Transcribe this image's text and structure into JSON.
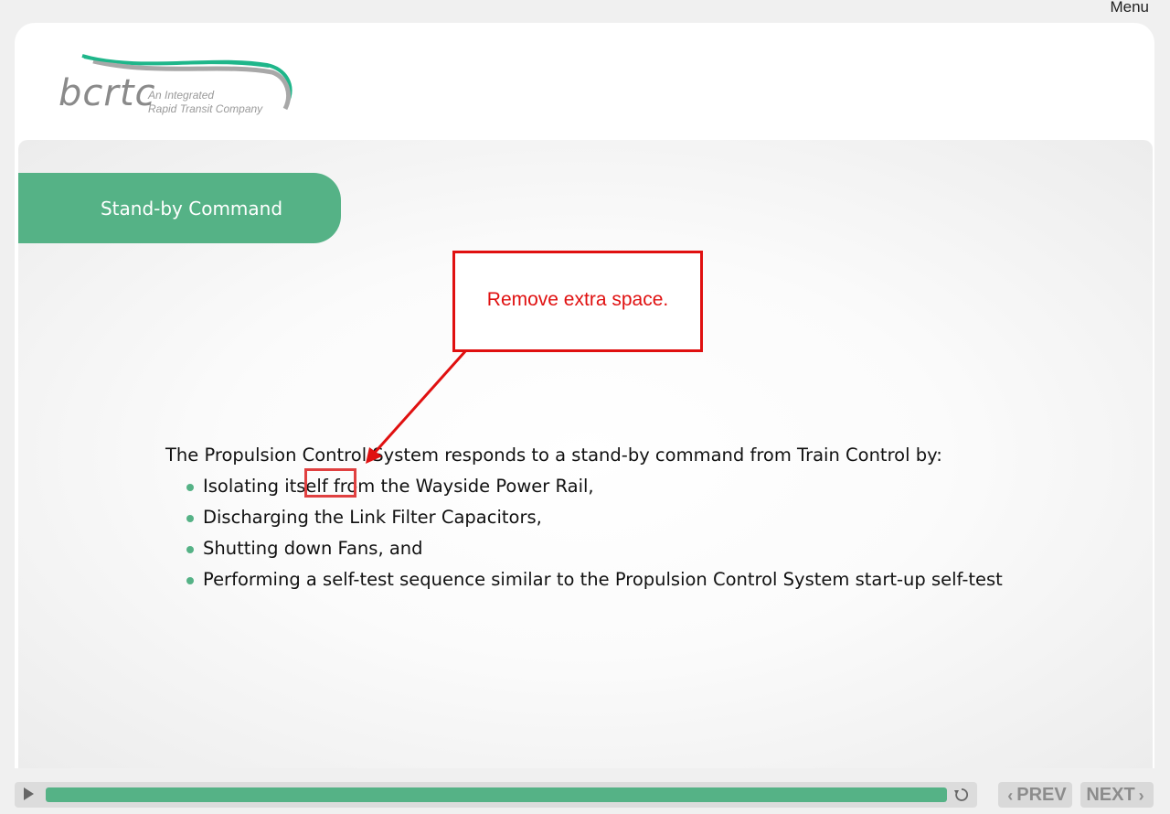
{
  "header": {
    "menu_label": "Menu"
  },
  "logo": {
    "wordmark": "bcrtc",
    "tagline_line1": "An Integrated",
    "tagline_line2": "Rapid Transit Company",
    "swoosh_colors": [
      "#1fb68a",
      "#a8a8a8"
    ]
  },
  "slide": {
    "title": "Stand-by Command",
    "intro": "The Propulsion Control System responds to a stand-by command from Train Control by:",
    "bullets": [
      "Isolating itself  from the Wayside Power Rail,",
      "Discharging the Link Filter Capacitors,",
      "Shutting down Fans, and",
      "Performing a self-test sequence similar to the Propulsion Control System start-up self-test"
    ]
  },
  "annotation": {
    "callout_text": "Remove extra space.",
    "color": "#e01010"
  },
  "player": {
    "progress_fraction": 1.0,
    "prev_label": "PREV",
    "next_label": "NEXT"
  },
  "colors": {
    "accent": "#55b286",
    "annotation": "#e01010"
  }
}
